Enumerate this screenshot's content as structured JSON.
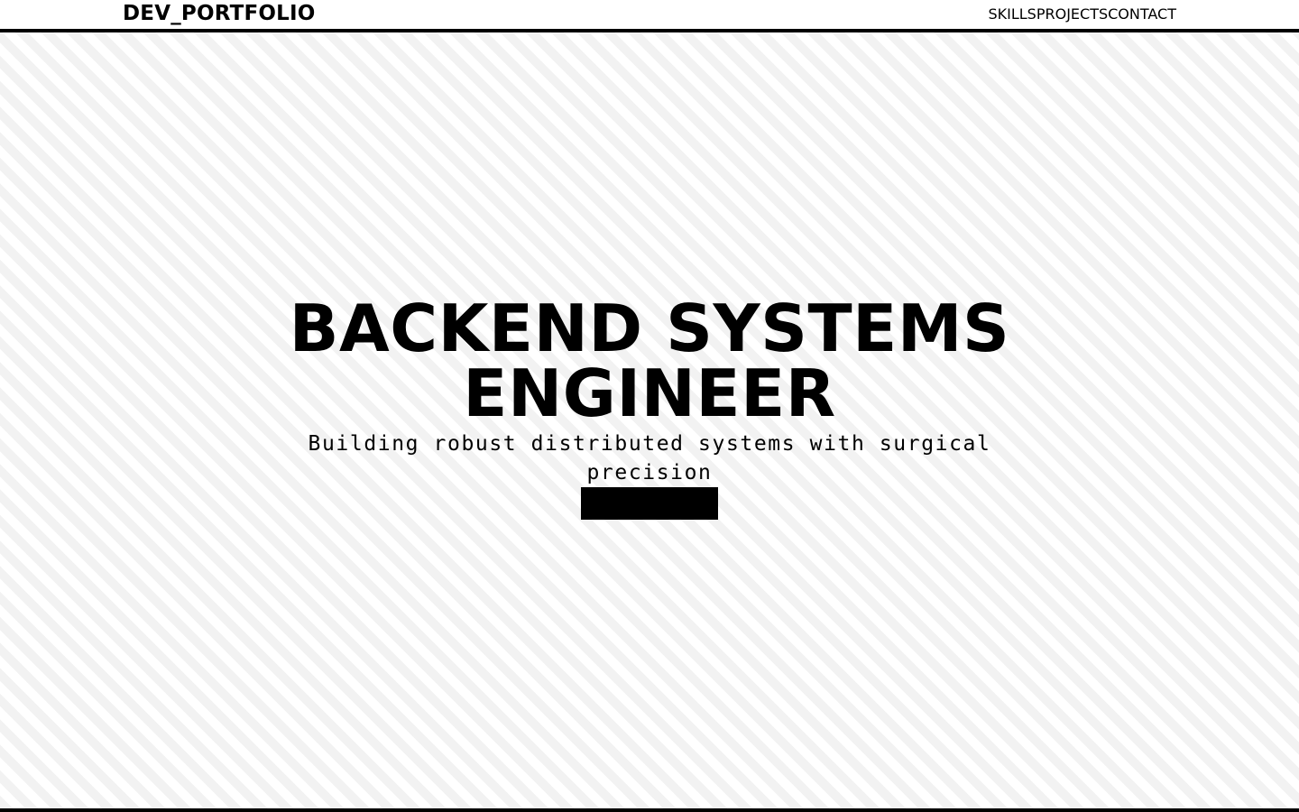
{
  "header": {
    "logo": "DEV_PORTFOLIO",
    "nav": [
      {
        "label": "SKILLS"
      },
      {
        "label": "PROJECTS"
      },
      {
        "label": "CONTACT"
      }
    ]
  },
  "hero": {
    "title": "BACKEND SYSTEMS ENGINEER",
    "subtitle": "Building robust distributed systems with surgical precision",
    "cta_label": ""
  },
  "colors": {
    "background": "#ffffff",
    "text": "#000000",
    "stripe": "#f2f2f2",
    "button": "#000000"
  }
}
